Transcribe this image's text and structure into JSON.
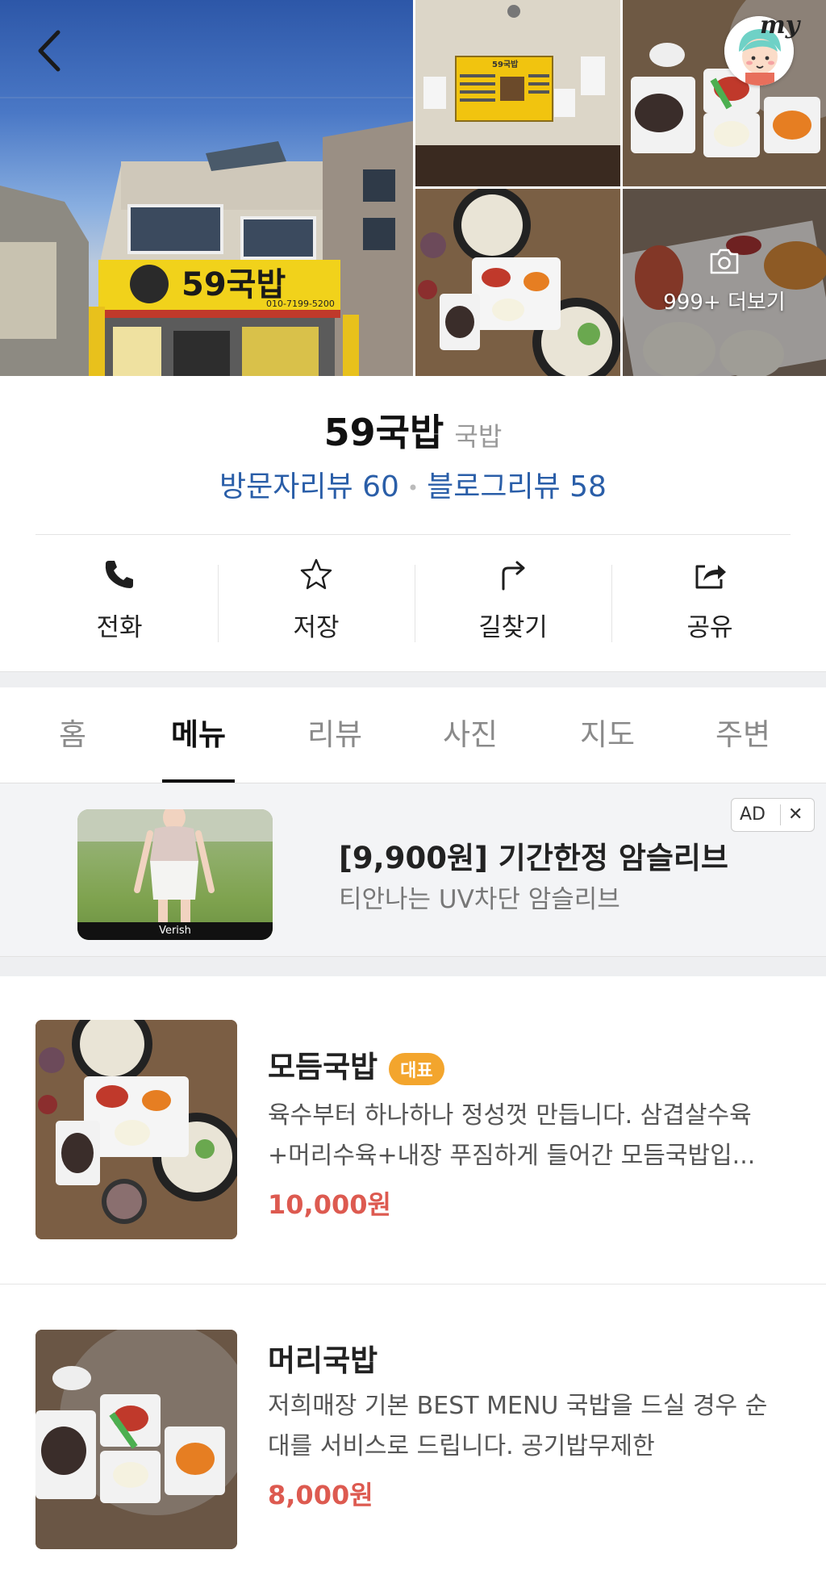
{
  "header": {
    "my_label": "my",
    "more_photos_label": "999+ 더보기",
    "storefront_sign": "59국밥",
    "storefront_phone": "010-7199-5200",
    "menu_board_title": "59국밥"
  },
  "place": {
    "name": "59국밥",
    "category": "국밥",
    "visitor_reviews_label": "방문자리뷰",
    "visitor_reviews_count": "60",
    "blog_reviews_label": "블로그리뷰",
    "blog_reviews_count": "58"
  },
  "actions": [
    {
      "label": "전화",
      "icon": "phone-icon"
    },
    {
      "label": "저장",
      "icon": "star-icon"
    },
    {
      "label": "길찾기",
      "icon": "directions-icon"
    },
    {
      "label": "공유",
      "icon": "share-icon"
    }
  ],
  "tabs": [
    {
      "label": "홈",
      "active": false
    },
    {
      "label": "메뉴",
      "active": true
    },
    {
      "label": "리뷰",
      "active": false
    },
    {
      "label": "사진",
      "active": false
    },
    {
      "label": "지도",
      "active": false
    },
    {
      "label": "주변",
      "active": false
    }
  ],
  "ad": {
    "title": "[9,900원] 기간한정 암슬리브",
    "subtitle": "티안나는 UV차단 암슬리브",
    "badge": "AD",
    "close": "✕",
    "brand": "Verish"
  },
  "menu_items": [
    {
      "name": "모듬국밥",
      "badge": "대표",
      "desc_line1": "육수부터 하나하나 정성껏 만듭니다. 삼겹살수육",
      "desc_line2": "+머리수육+내장 푸짐하게 들어간 모듬국밥입...",
      "price": "10,000원"
    },
    {
      "name": "머리국밥",
      "badge": "",
      "desc_line1": "저희매장 기본 BEST MENU 국밥을 드실 경우 순",
      "desc_line2": "대를 서비스로 드립니다. 공기밥무제한",
      "price": "8,000원"
    }
  ],
  "colors": {
    "review_link": "#2a5ea8",
    "price": "#dd5a50",
    "badge": "#f3a52d"
  }
}
